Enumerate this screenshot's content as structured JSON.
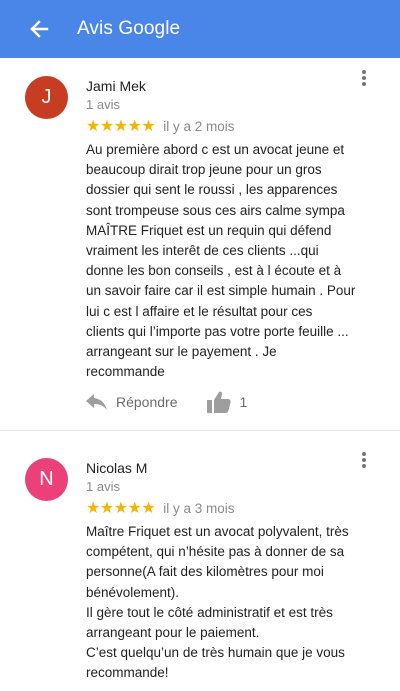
{
  "appbar": {
    "title": "Avis Google",
    "back_icon": "arrow-back-icon",
    "color": "#4a86e8"
  },
  "reviews": [
    {
      "avatar_letter": "J",
      "avatar_color": "#c73d22",
      "author": "Jami Mek",
      "review_count": "1 avis",
      "stars": "★★★★★",
      "rating": 5,
      "date": "il y a 2 mois",
      "text": "Au première abord c est un avocat jeune et\nbeaucoup dirait trop jeune pour un gros\ndossier qui sent le roussi , les apparences\nsont trompeuse sous ces airs calme sympa\nMAÎTRE Friquet est un requin qui défend\nvraiment les interêt de ces clients ...qui\ndonne les bon conseils , est à l écoute et à\nun savoir faire car il est simple humain . Pour\nlui c est l affaire et le résultat pour ces\nclients qui l’importe pas votre porte feuille ...\narrangeant sur le payement . Je\nrecommande",
      "reply_label": "Répondre",
      "like_count": "1"
    },
    {
      "avatar_letter": "N",
      "avatar_color": "#ec407a",
      "author": "Nicolas M",
      "review_count": "1 avis",
      "stars": "★★★★★",
      "rating": 5,
      "date": "il y a 3 mois",
      "text": "Maître Friquet est un avocat polyvalent, très\ncompétent, qui n’hésite pas à donner de sa\npersonne(A fait des kilomètres pour moi\nbénévolement).\nIl gère tout le côté administratif et est très\narrangeant pour le paiement.\nC’est quelqu’un de très humain que je vous\nrecommande!"
    }
  ]
}
